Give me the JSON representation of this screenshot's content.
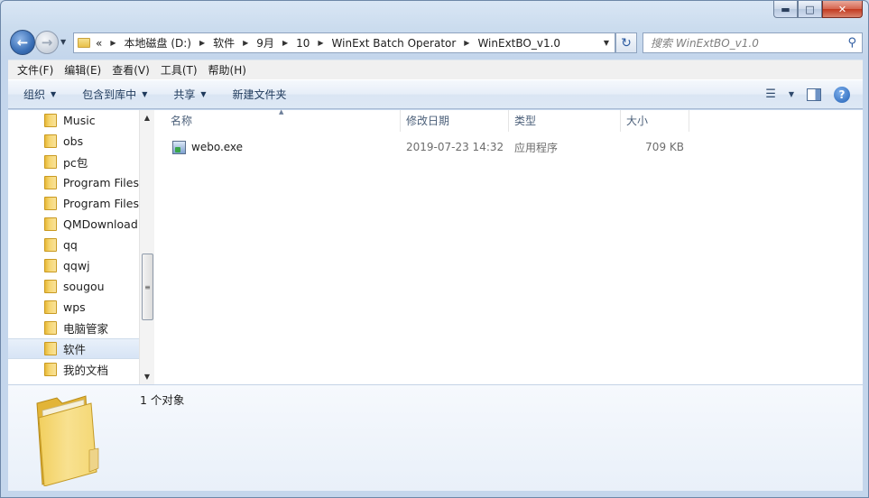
{
  "window": {
    "caption_minimize": "▭",
    "caption_maximize": "□",
    "caption_close": "✕"
  },
  "address_bar": {
    "overflow": "«",
    "crumbs": [
      "本地磁盘 (D:)",
      "软件",
      "9月",
      "10",
      "WinExt Batch Operator",
      "WinExtBO_v1.0"
    ]
  },
  "search": {
    "placeholder": "搜索 WinExtBO_v1.0"
  },
  "menubar": {
    "items": [
      "文件(F)",
      "编辑(E)",
      "查看(V)",
      "工具(T)",
      "帮助(H)"
    ]
  },
  "toolbar": {
    "organize": "组织",
    "include_library": "包含到库中",
    "share": "共享",
    "new_folder": "新建文件夹",
    "help": "?"
  },
  "nav_pane": {
    "items": [
      {
        "label": "Music",
        "selected": false
      },
      {
        "label": "obs",
        "selected": false
      },
      {
        "label": "pc包",
        "selected": false
      },
      {
        "label": "Program Files",
        "selected": false
      },
      {
        "label": "Program Files",
        "selected": false
      },
      {
        "label": "QMDownload",
        "selected": false
      },
      {
        "label": "qq",
        "selected": false
      },
      {
        "label": "qqwj",
        "selected": false
      },
      {
        "label": "sougou",
        "selected": false
      },
      {
        "label": "wps",
        "selected": false
      },
      {
        "label": "电脑管家",
        "selected": false
      },
      {
        "label": "软件",
        "selected": true
      },
      {
        "label": "我的文档",
        "selected": false
      }
    ]
  },
  "file_list": {
    "columns": {
      "name": "名称",
      "date": "修改日期",
      "type": "类型",
      "size": "大小"
    },
    "rows": [
      {
        "name": "webo.exe",
        "date": "2019-07-23 14:32",
        "type": "应用程序",
        "size": "709 KB"
      }
    ]
  },
  "details_pane": {
    "status": "1 个对象"
  },
  "colors": {
    "accent": "#2c5aa0",
    "folder": "#f3d36b",
    "selection": "#d7e4f5"
  }
}
